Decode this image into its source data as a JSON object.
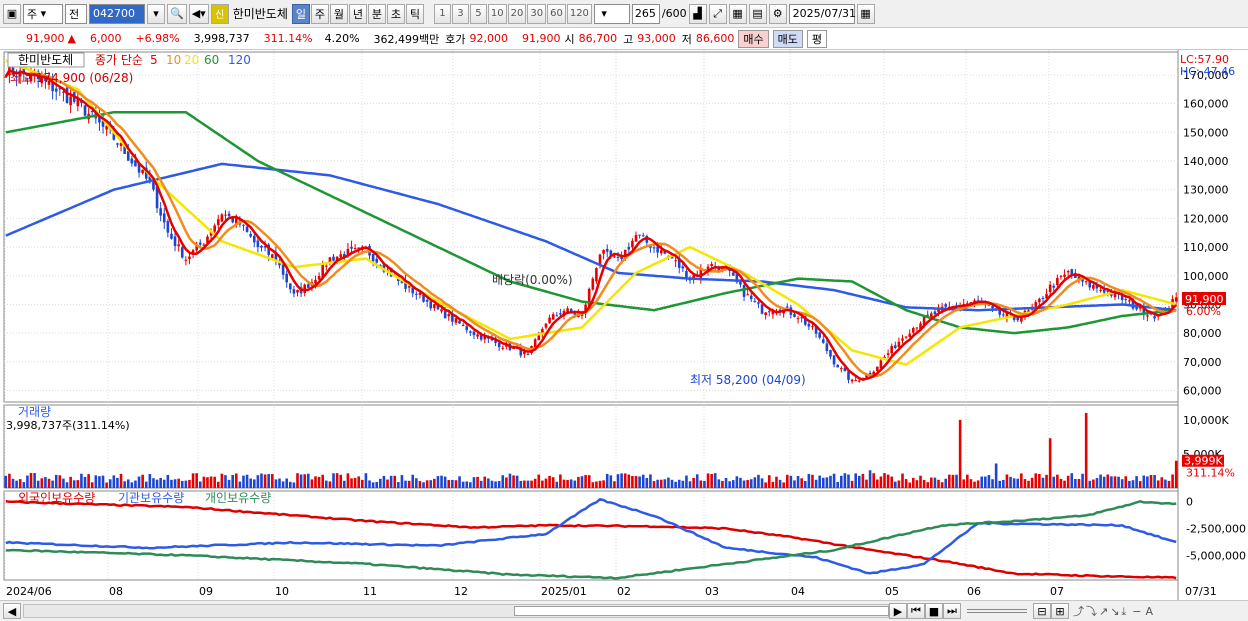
{
  "toolbar": {
    "market": "주",
    "type": "전",
    "code": "042700",
    "credit_badge": "신",
    "name": "한미반도체",
    "periods": [
      "일",
      "주",
      "월",
      "년",
      "분",
      "초",
      "틱"
    ],
    "active_period": "일",
    "intervals": [
      "1",
      "3",
      "5",
      "10",
      "20",
      "30",
      "60",
      "120"
    ],
    "count": "265",
    "count_max": "/600",
    "date": "2025/07/31"
  },
  "quote": {
    "price": "91,900",
    "change_arrow": "▲",
    "change": "6,000",
    "change_pct": "+6.98%",
    "volume": "3,998,737",
    "volume_ratio": "311.14%",
    "turnover_pct": "4.20%",
    "amount": "362,499백만",
    "bid_label": "호가",
    "bid": "92,000",
    "ask": "91,900",
    "open_label": "시",
    "open": "86,700",
    "high_label": "고",
    "high": "93,000",
    "low_label": "저",
    "low": "86,600",
    "buy_label": "매수",
    "sell_label": "매도",
    "eval_label": "평"
  },
  "colors": {
    "up": "#e60000",
    "down": "#1c46d2",
    "ma5": "#e60000",
    "ma10": "#f08c1e",
    "ma20": "#f5e600",
    "ma60": "#1e9632",
    "ma120": "#2d5ae6"
  },
  "chart_data": [
    {
      "type": "candlestick",
      "title": "한미반도체",
      "legend_prefix": "종가 단순",
      "ma_periods": [
        "5",
        "10",
        "20",
        "60",
        "120"
      ],
      "y_ticks": [
        "170,000",
        "160,000",
        "150,000",
        "140,000",
        "130,000",
        "120,000",
        "110,000",
        "100,000",
        "90,000",
        "80,000",
        "70,000",
        "60,000"
      ],
      "ylim": [
        56000,
        178000
      ],
      "x_ticks": [
        "2024/06",
        "08",
        "09",
        "10",
        "11",
        "12",
        "2025/01",
        "02",
        "03",
        "04",
        "05",
        "06",
        "07",
        "07/31"
      ],
      "annotations": {
        "high": "최고 174,900 (06/28)",
        "low": "최저 58,200 (04/09)",
        "dividend": "배당락(0.00%)",
        "lc": "LC:57.90",
        "hc": "HC:-47.46",
        "last_price": "91,900",
        "last_pct": "6.00%"
      },
      "close_path": [
        [
          0,
          172000
        ],
        [
          10,
          168000
        ],
        [
          20,
          160000
        ],
        [
          30,
          148000
        ],
        [
          40,
          132000
        ],
        [
          45,
          115000
        ],
        [
          50,
          106000
        ],
        [
          55,
          112000
        ],
        [
          60,
          122000
        ],
        [
          65,
          118000
        ],
        [
          70,
          110000
        ],
        [
          75,
          106000
        ],
        [
          80,
          93000
        ],
        [
          85,
          98000
        ],
        [
          90,
          106000
        ],
        [
          95,
          108000
        ],
        [
          100,
          109000
        ],
        [
          105,
          103000
        ],
        [
          110,
          97000
        ],
        [
          115,
          93000
        ],
        [
          120,
          88000
        ],
        [
          125,
          84000
        ],
        [
          130,
          80000
        ],
        [
          135,
          77000
        ],
        [
          140,
          75000
        ],
        [
          145,
          72000
        ],
        [
          150,
          84000
        ],
        [
          155,
          88000
        ],
        [
          160,
          86000
        ],
        [
          165,
          108000
        ],
        [
          170,
          105000
        ],
        [
          175,
          114000
        ],
        [
          180,
          110000
        ],
        [
          185,
          106000
        ],
        [
          190,
          99000
        ],
        [
          195,
          104000
        ],
        [
          200,
          102000
        ],
        [
          205,
          94000
        ],
        [
          210,
          88000
        ],
        [
          215,
          89000
        ],
        [
          220,
          86000
        ],
        [
          225,
          80000
        ],
        [
          230,
          70000
        ],
        [
          235,
          63000
        ],
        [
          240,
          66000
        ],
        [
          245,
          73000
        ],
        [
          250,
          80000
        ],
        [
          255,
          85000
        ],
        [
          260,
          88000
        ],
        [
          265,
          90000
        ],
        [
          270,
          91000
        ],
        [
          275,
          87000
        ],
        [
          280,
          85000
        ],
        [
          285,
          88000
        ],
        [
          290,
          96000
        ],
        [
          295,
          101000
        ],
        [
          300,
          97000
        ],
        [
          305,
          95000
        ],
        [
          310,
          92000
        ],
        [
          315,
          88000
        ],
        [
          320,
          86000
        ],
        [
          325,
          91900
        ]
      ],
      "ma20_path": [
        [
          0,
          175000
        ],
        [
          20,
          165000
        ],
        [
          40,
          135000
        ],
        [
          60,
          112000
        ],
        [
          80,
          103000
        ],
        [
          100,
          106000
        ],
        [
          120,
          91000
        ],
        [
          140,
          78000
        ],
        [
          160,
          82000
        ],
        [
          175,
          101000
        ],
        [
          190,
          110000
        ],
        [
          205,
          101000
        ],
        [
          220,
          90000
        ],
        [
          235,
          74000
        ],
        [
          250,
          69000
        ],
        [
          265,
          82000
        ],
        [
          280,
          86000
        ],
        [
          295,
          90000
        ],
        [
          310,
          95000
        ],
        [
          325,
          90000
        ]
      ],
      "ma60_path": [
        [
          0,
          150000
        ],
        [
          30,
          157000
        ],
        [
          50,
          157000
        ],
        [
          70,
          140000
        ],
        [
          100,
          122000
        ],
        [
          120,
          110000
        ],
        [
          140,
          98000
        ],
        [
          160,
          91000
        ],
        [
          180,
          88000
        ],
        [
          200,
          94000
        ],
        [
          220,
          99000
        ],
        [
          235,
          98000
        ],
        [
          250,
          88000
        ],
        [
          265,
          82000
        ],
        [
          280,
          80000
        ],
        [
          295,
          82000
        ],
        [
          310,
          86000
        ],
        [
          325,
          88000
        ]
      ],
      "ma120_path": [
        [
          0,
          114000
        ],
        [
          30,
          130000
        ],
        [
          60,
          139000
        ],
        [
          90,
          135000
        ],
        [
          120,
          125000
        ],
        [
          150,
          112000
        ],
        [
          170,
          101000
        ],
        [
          190,
          99000
        ],
        [
          210,
          98000
        ],
        [
          230,
          95000
        ],
        [
          250,
          89000
        ],
        [
          270,
          88000
        ],
        [
          290,
          89000
        ],
        [
          310,
          90000
        ],
        [
          325,
          88000
        ]
      ]
    },
    {
      "type": "bar",
      "title": "거래량",
      "current": "3,998,737주(311.14%)",
      "y_ticks": [
        "10,000K",
        "5,000K"
      ],
      "ylim": [
        0,
        11000
      ],
      "last_value": "3,999K",
      "last_pct": "311.14%",
      "spikes": [
        [
          230,
          2100
        ],
        [
          240,
          2600
        ],
        [
          265,
          10000
        ],
        [
          275,
          3600
        ],
        [
          290,
          7300
        ],
        [
          300,
          11000
        ],
        [
          325,
          3999
        ]
      ]
    },
    {
      "type": "line",
      "series": [
        {
          "name": "외국인보유수량",
          "color": "#dd0000",
          "values": [
            [
              0,
              0
            ],
            [
              50,
              -500000
            ],
            [
              100,
              -1800000
            ],
            [
              130,
              -2400000
            ],
            [
              150,
              -2200000
            ],
            [
              180,
              -2300000
            ],
            [
              200,
              -2500000
            ],
            [
              220,
              -3400000
            ],
            [
              240,
              -4500000
            ],
            [
              260,
              -5500000
            ],
            [
              280,
              -6700000
            ],
            [
              300,
              -6900000
            ],
            [
              325,
              -7100000
            ]
          ]
        },
        {
          "name": "기관보유수량",
          "color": "#2d5ae6",
          "values": [
            [
              0,
              -3800000
            ],
            [
              40,
              -4300000
            ],
            [
              80,
              -3800000
            ],
            [
              120,
              -4100000
            ],
            [
              150,
              -3000000
            ],
            [
              165,
              200000
            ],
            [
              180,
              -1300000
            ],
            [
              200,
              -4300000
            ],
            [
              225,
              -5200000
            ],
            [
              240,
              -6700000
            ],
            [
              255,
              -5800000
            ],
            [
              270,
              -2000000
            ],
            [
              290,
              -2100000
            ],
            [
              310,
              -2200000
            ],
            [
              325,
              -3800000
            ]
          ]
        },
        {
          "name": "개인보유수량",
          "color": "#2e8b57",
          "values": [
            [
              0,
              -4500000
            ],
            [
              50,
              -5000000
            ],
            [
              100,
              -5800000
            ],
            [
              140,
              -6800000
            ],
            [
              170,
              -7100000
            ],
            [
              200,
              -5800000
            ],
            [
              230,
              -4500000
            ],
            [
              260,
              -2200000
            ],
            [
              280,
              -1800000
            ],
            [
              300,
              -1300000
            ],
            [
              315,
              0
            ],
            [
              325,
              -200000
            ]
          ]
        }
      ],
      "y_ticks": [
        "0",
        "-2,500,000",
        "-5,000,000"
      ],
      "ylim": [
        -7300000,
        1000000
      ]
    }
  ]
}
